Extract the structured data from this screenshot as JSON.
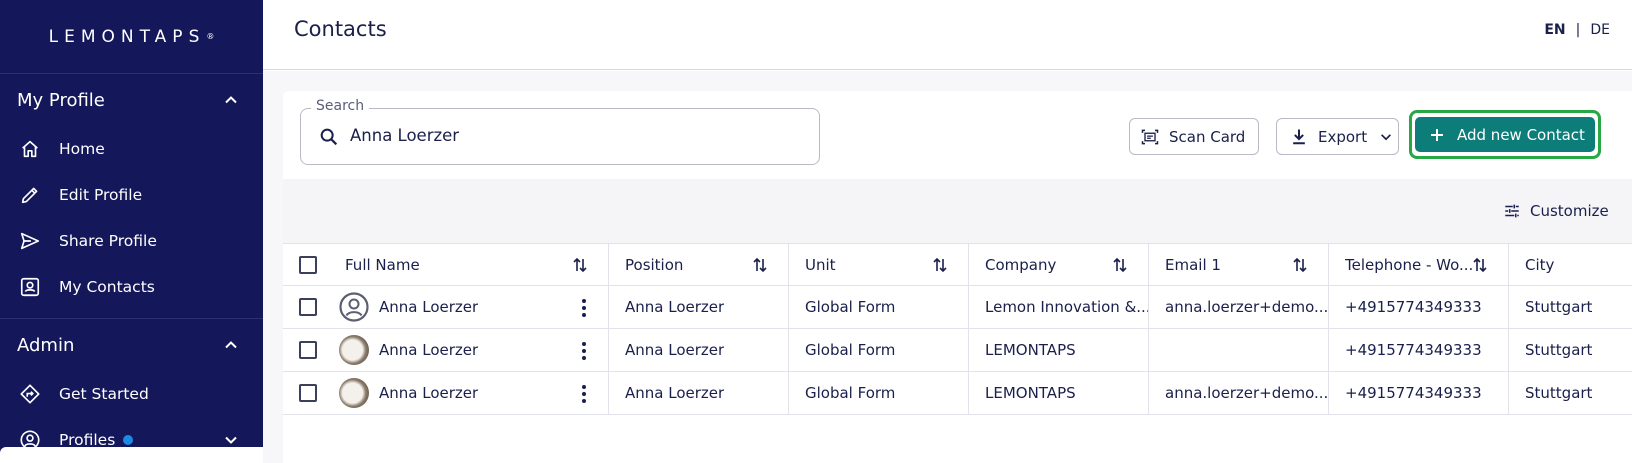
{
  "sidebar": {
    "logo": "LEMONTAPS",
    "logo_mark": "®",
    "sections": [
      {
        "title": "My Profile",
        "items": [
          {
            "label": "Home",
            "icon": "home-icon"
          },
          {
            "label": "Edit Profile",
            "icon": "pencil-icon"
          },
          {
            "label": "Share Profile",
            "icon": "send-icon"
          },
          {
            "label": "My Contacts",
            "icon": "contacts-card-icon"
          }
        ]
      },
      {
        "title": "Admin",
        "items": [
          {
            "label": "Get Started",
            "icon": "directions-icon"
          },
          {
            "label": "Profiles",
            "icon": "user-circle-icon"
          }
        ]
      }
    ]
  },
  "header": {
    "title": "Contacts",
    "lang_en": "EN",
    "lang_sep": "|",
    "lang_de": "DE"
  },
  "search": {
    "label": "Search",
    "value": "Anna Loerzer"
  },
  "actions": {
    "scan_card": "Scan Card",
    "export": "Export",
    "add_contact": "Add new Contact",
    "customize": "Customize"
  },
  "table": {
    "columns": [
      "Full Name",
      "Position",
      "Unit",
      "Company",
      "Email 1",
      "Telephone - Wo...",
      "City"
    ],
    "rows": [
      {
        "name": "Anna Loerzer",
        "avatar": "default",
        "position": "Anna Loerzer",
        "unit": "Global Form",
        "company": "Lemon Innovation &...",
        "email": "anna.loerzer+demo...",
        "phone": "+4915774349333",
        "city": "Stuttgart"
      },
      {
        "name": "Anna Loerzer",
        "avatar": "photo",
        "position": "Anna Loerzer",
        "unit": "Global Form",
        "company": "LEMONTAPS",
        "email": "",
        "phone": "+4915774349333",
        "city": "Stuttgart"
      },
      {
        "name": "Anna Loerzer",
        "avatar": "photo",
        "position": "Anna Loerzer",
        "unit": "Global Form",
        "company": "LEMONTAPS",
        "email": "anna.loerzer+demo...",
        "phone": "+4915774349333",
        "city": "Stuttgart"
      }
    ]
  },
  "colors": {
    "sidebar_bg": "#14175a",
    "primary_button": "#0d7d7a",
    "highlight_border": "#28a745",
    "badge_dot": "#1e88e5"
  }
}
